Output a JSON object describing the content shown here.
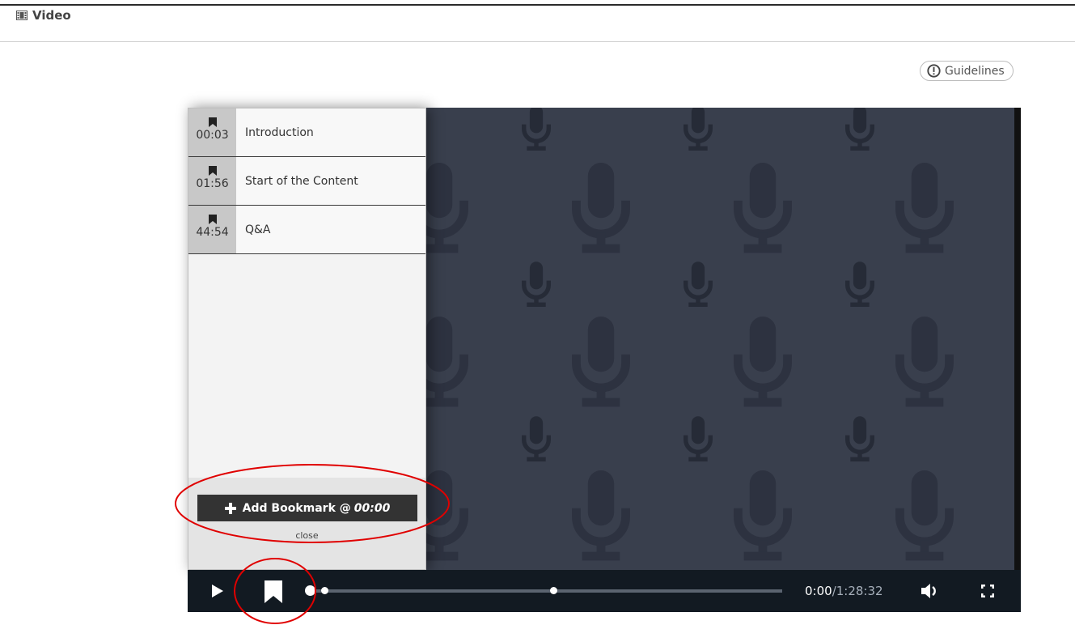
{
  "header": {
    "title": "Video",
    "icon": "film-icon"
  },
  "guidelines": {
    "label": "Guidelines",
    "icon": "exclamation-circle-icon"
  },
  "player": {
    "background_color": "#393f4d",
    "background_icon": "microphone-icon",
    "bookmarks": [
      {
        "time": "00:03",
        "title": "Introduction"
      },
      {
        "time": "01:56",
        "title": "Start of the Content"
      },
      {
        "time": "44:54",
        "title": "Q&A"
      }
    ],
    "add_bookmark": {
      "label": "Add Bookmark @",
      "time": "00:00"
    },
    "close_label": "close",
    "controls": {
      "current_time": "0:00",
      "separator": "/",
      "duration": "1:28:32",
      "progress_fraction": 0
    }
  },
  "annotation_color": "#e00000"
}
